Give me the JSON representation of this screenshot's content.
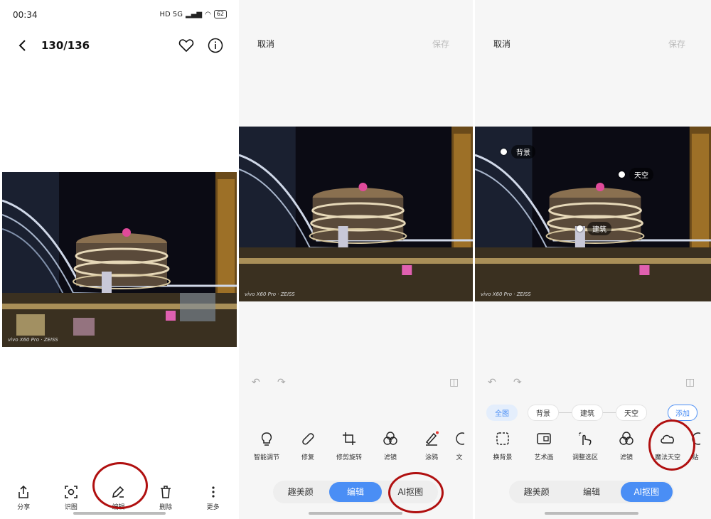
{
  "panel1": {
    "status_time": "00:34",
    "status_icons": "HD 5G",
    "battery": "62",
    "counter": "130/136",
    "watermark": "vivo X60 Pro · ZEISS",
    "bottom_tools": [
      {
        "label": "分享",
        "icon": "share-icon"
      },
      {
        "label": "识图",
        "icon": "scan-icon"
      },
      {
        "label": "编辑",
        "icon": "edit-pen-icon"
      },
      {
        "label": "删除",
        "icon": "trash-icon"
      },
      {
        "label": "更多",
        "icon": "more-dots-icon"
      }
    ]
  },
  "panel2": {
    "cancel": "取消",
    "save": "保存",
    "watermark": "vivo X60 Pro · ZEISS",
    "tools": [
      {
        "label": "智能调节",
        "icon": "bulb-icon"
      },
      {
        "label": "修复",
        "icon": "bandage-icon"
      },
      {
        "label": "修剪旋转",
        "icon": "crop-rotate-icon"
      },
      {
        "label": "滤镜",
        "icon": "filter-icon"
      },
      {
        "label": "涂鸦",
        "icon": "brush-icon"
      },
      {
        "label": "文",
        "icon": "text-icon"
      }
    ],
    "modes": [
      "趣美颜",
      "编辑",
      "AI抠图"
    ],
    "active_mode": "编辑"
  },
  "panel3": {
    "cancel": "取消",
    "save": "保存",
    "watermark": "vivo X60 Pro · ZEISS",
    "pins": {
      "background": "背景",
      "sky": "天空",
      "building": "建筑"
    },
    "chips": [
      "全图",
      "背景",
      "建筑",
      "天空"
    ],
    "add": "添加",
    "tools": [
      {
        "label": "换背景",
        "icon": "replace-bg-icon"
      },
      {
        "label": "艺术画",
        "icon": "art-frame-icon"
      },
      {
        "label": "调整选区",
        "icon": "adjust-selection-icon"
      },
      {
        "label": "滤镜",
        "icon": "filter-icon"
      },
      {
        "label": "魔法天空",
        "icon": "cloud-icon"
      },
      {
        "label": "贴",
        "icon": "sticker-icon"
      }
    ],
    "modes": [
      "趣美颜",
      "编辑",
      "AI抠图"
    ],
    "active_mode": "AI抠图"
  },
  "colors": {
    "accent": "#4a8ef5",
    "annotation": "#b01010"
  }
}
